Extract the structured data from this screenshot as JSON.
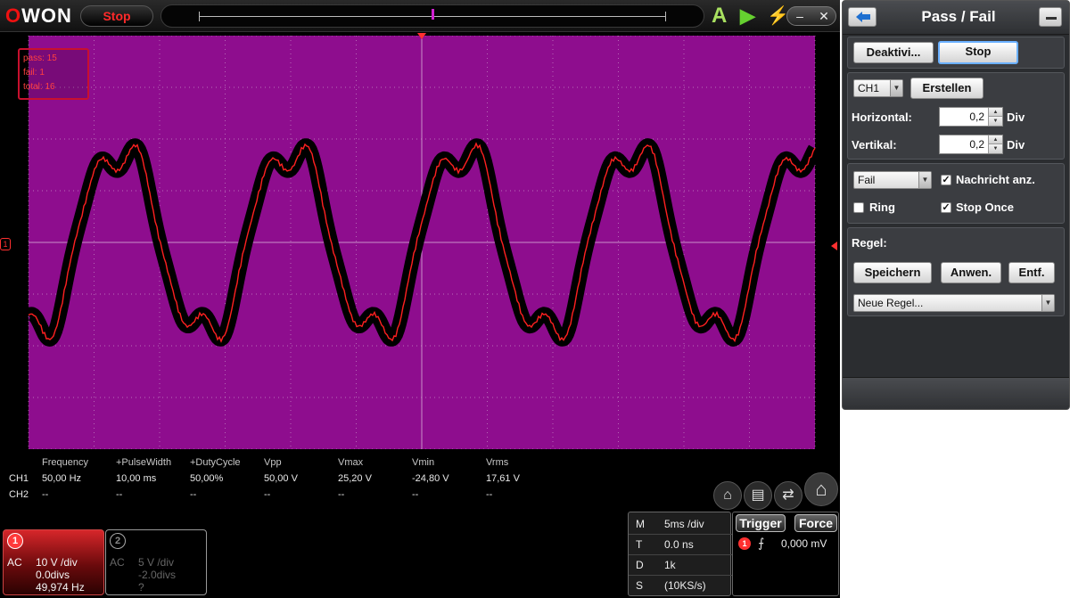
{
  "topbar": {
    "logo_o": "O",
    "logo_rest": "WON",
    "status": "Stop",
    "auto_label": "A"
  },
  "colors": {
    "screen_bg": "#8e0d8e",
    "grid": "#c890c8",
    "trace": "#ff2020",
    "envelope": "#000000",
    "accent": "#ff3030"
  },
  "passfail_counter": {
    "pass": "pass: 15",
    "fail": "fail: 1",
    "total": "total: 16"
  },
  "plot_marker": "1",
  "measurements": {
    "headers": [
      "Frequency",
      "+PulseWidth",
      "+DutyCycle",
      "Vpp",
      "Vmax",
      "Vmin",
      "Vrms"
    ],
    "rows": [
      {
        "label": "CH1",
        "values": [
          "50,00 Hz",
          "10,00 ms",
          "50,00%",
          "50,00 V",
          "25,20 V",
          "-24,80 V",
          "17,61 V"
        ]
      },
      {
        "label": "CH2",
        "values": [
          "--",
          "--",
          "--",
          "--",
          "--",
          "--",
          "--"
        ]
      }
    ]
  },
  "quick_icons": [
    "screenshot-icon",
    "save-icon",
    "swap-icon",
    "home-icon"
  ],
  "ch1": {
    "num": "1",
    "coupling": "AC",
    "scale": "10 V /div",
    "offset": "0.0divs",
    "freq": "49,974 Hz"
  },
  "ch2": {
    "num": "2",
    "coupling": "AC",
    "scale": "5 V /div",
    "offset": "-2.0divs",
    "freq": "?"
  },
  "timebase": [
    {
      "key": "M",
      "value": "5ms /div"
    },
    {
      "key": "T",
      "value": "0.0 ns"
    },
    {
      "key": "D",
      "value": "1k"
    },
    {
      "key": "S",
      "value": "(10KS/s)"
    }
  ],
  "trigger": {
    "trigger_label": "Trigger",
    "force_label": "Force",
    "channel": "1",
    "level": "0,000 mV"
  },
  "passfail": {
    "title": "Pass / Fail",
    "deactivate_label": "Deaktivi...",
    "stop_label": "Stop",
    "channel_select": "CH1",
    "create_label": "Erstellen",
    "horizontal_label": "Horizontal:",
    "horizontal_value": "0,2",
    "vertical_label": "Vertikal:",
    "vertical_value": "0,2",
    "div_label": "Div",
    "output_select": "Fail",
    "message_label": "Nachricht anz.",
    "message_checked": true,
    "ring_label": "Ring",
    "ring_checked": false,
    "stop_once_label": "Stop Once",
    "stop_once_checked": true,
    "rule_label": "Regel:",
    "save_label": "Speichern",
    "apply_label": "Anwen.",
    "delete_label": "Entf.",
    "rule_select": "Neue Regel..."
  }
}
